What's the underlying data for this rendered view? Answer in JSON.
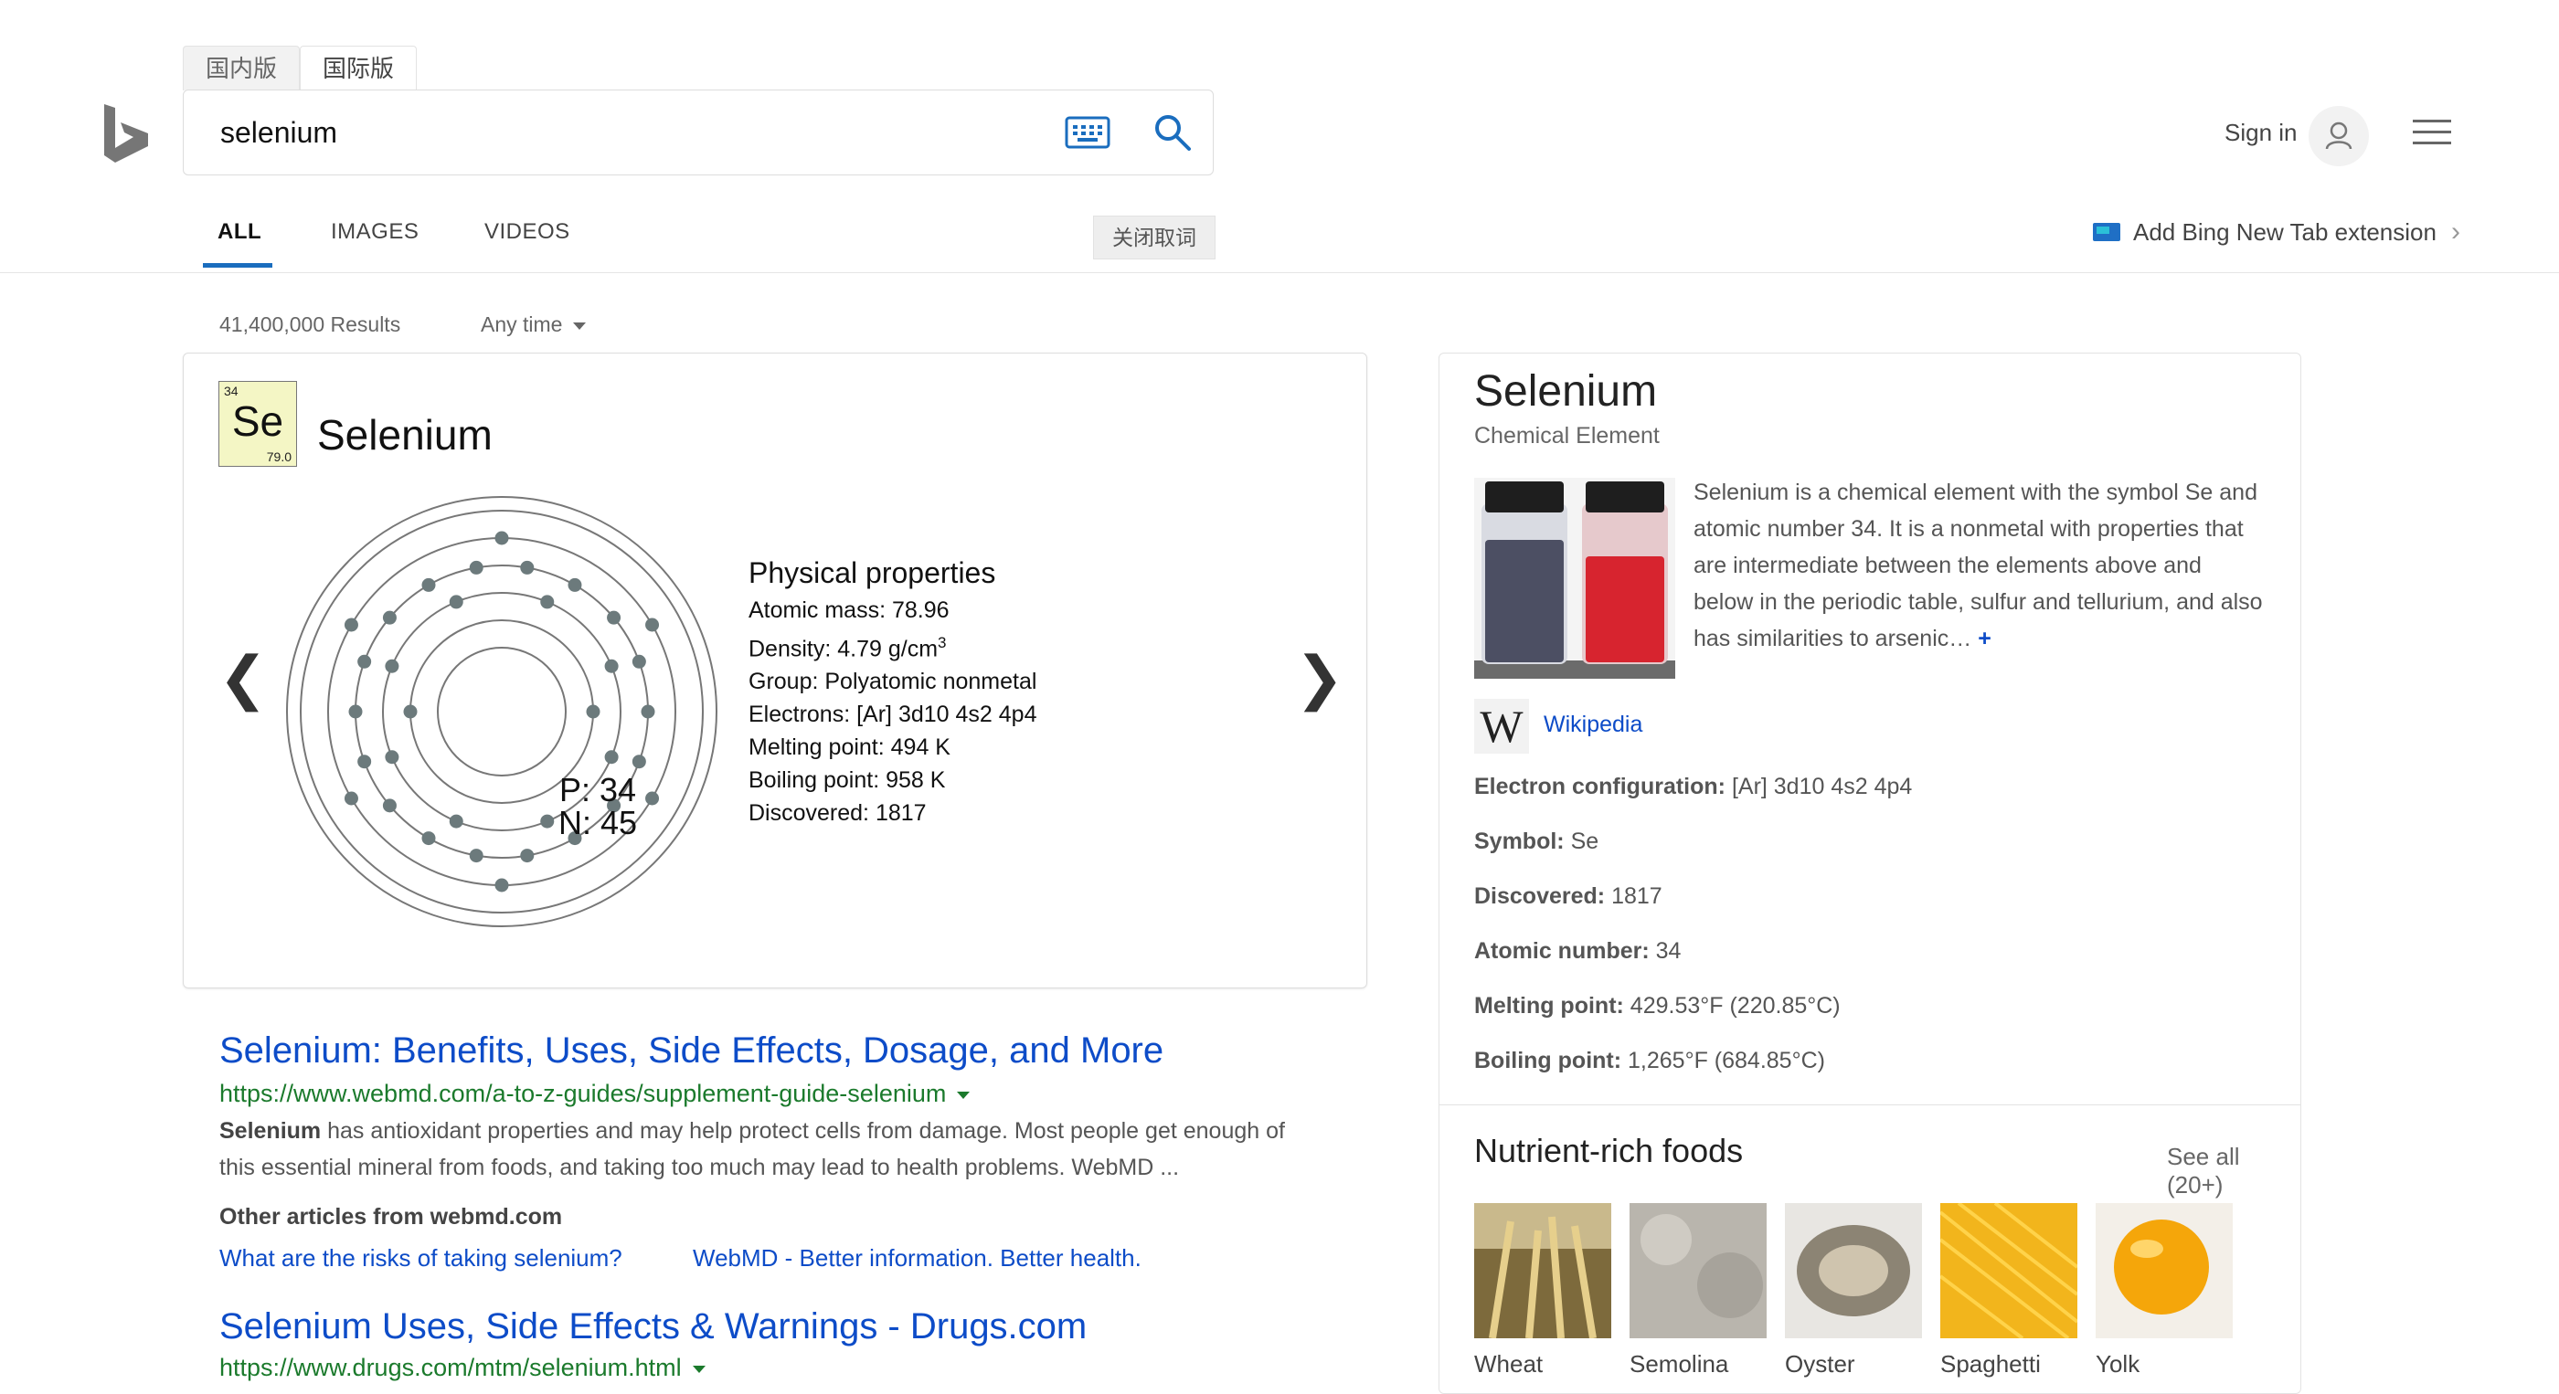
{
  "header": {
    "version_tabs": [
      "国内版",
      "国际版"
    ],
    "search_query": "selenium",
    "sign_in": "Sign in"
  },
  "scope_tabs": [
    "ALL",
    "IMAGES",
    "VIDEOS"
  ],
  "close_words_button": "关闭取词",
  "extension_link": "Add Bing New Tab extension",
  "results_count": "41,400,000 Results",
  "time_filter": "Any time",
  "element_card": {
    "atomic_number": "34",
    "symbol": "Se",
    "tile_mass": "79.0",
    "name": "Selenium",
    "protons": "P: 34",
    "neutrons": "N: 45",
    "properties_title": "Physical properties",
    "atomic_mass": "Atomic mass: 78.96",
    "density_prefix": "Density: 4.79 g/cm",
    "density_sup": "3",
    "group": "Group: Polyatomic nonmetal",
    "electrons": "Electrons: [Ar] 3d10 4s2 4p4",
    "melting": "Melting point: 494 K",
    "boiling": "Boiling point: 958 K",
    "discovered": "Discovered: 1817"
  },
  "results": [
    {
      "title": "Selenium: Benefits, Uses, Side Effects, Dosage, and More",
      "url": "https://www.webmd.com/a-to-z-guides/supplement-guide-selenium",
      "snippet_bold": "Selenium",
      "snippet_rest": " has antioxidant properties and may help protect cells from damage. Most people get enough of",
      "snippet_line2": "this essential mineral from foods, and taking too much may lead to health problems. WebMD ...",
      "other_heading": "Other articles from webmd.com",
      "deep_links": [
        "What are the risks of taking selenium?",
        "WebMD - Better information. Better health."
      ]
    },
    {
      "title": "Selenium Uses, Side Effects & Warnings - Drugs.com",
      "url": "https://www.drugs.com/mtm/selenium.html"
    }
  ],
  "knowledge_panel": {
    "title": "Selenium",
    "subtitle": "Chemical Element",
    "description": "Selenium is a chemical element with the symbol Se and atomic number 34. It is a nonmetal with properties that are intermediate between the elements above and below in the periodic table, sulfur and tellurium, and also has similarities to arsenic…",
    "more": "+",
    "wiki_label": "Wikipedia",
    "facts": [
      {
        "label": "Electron configuration:",
        "value": " [Ar] 3d10 4s2 4p4"
      },
      {
        "label": "Symbol:",
        "value": " Se"
      },
      {
        "label": "Discovered:",
        "value": " 1817"
      },
      {
        "label": "Atomic number:",
        "value": " 34"
      },
      {
        "label": "Melting point:",
        "value": " 429.53°F (220.85°C)"
      },
      {
        "label": "Boiling point:",
        "value": " 1,265°F (684.85°C)"
      }
    ],
    "foods_title": "Nutrient-rich foods",
    "see_all": "See all (20+)",
    "foods": [
      "Wheat",
      "Semolina",
      "Oyster",
      "Spaghetti",
      "Yolk"
    ]
  },
  "colors": {
    "link_blue": "#0d4cc8",
    "url_green": "#1b7a2c",
    "tab_underline": "#1a6dbe",
    "element_tile": "#f4f6c5"
  },
  "icons": [
    "bing-logo-icon",
    "keyboard-icon",
    "search-icon",
    "user-icon",
    "hamburger-menu-icon",
    "chevron-left-icon",
    "chevron-right-icon",
    "wikipedia-icon"
  ]
}
